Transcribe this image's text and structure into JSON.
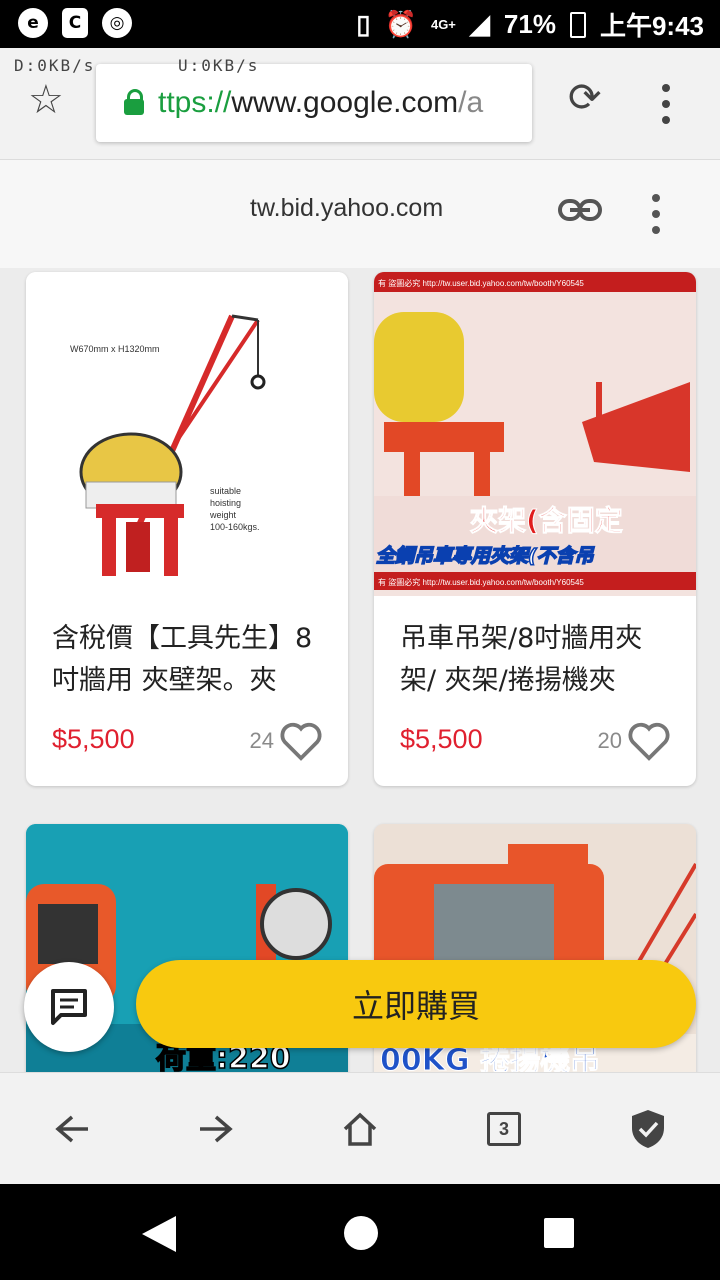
{
  "status_bar": {
    "battery": "71%",
    "time": "上午9:43",
    "network_type": "4G+",
    "net_down": "D:0KB/s",
    "net_up": "U:0KB/s"
  },
  "browser": {
    "url_scheme": "ttps://",
    "url_host": "www.google.com",
    "url_path": "/a",
    "domain": "tw.bid.yahoo.com",
    "tab_count": "3"
  },
  "products": [
    {
      "title": "含稅價【工具先生】8吋牆用 夾壁架。夾",
      "price": "$5,500",
      "likes": "24",
      "image_text": [
        "W670mm x H1320mm",
        "suitable",
        "hoisting",
        "weight",
        "100-160kgs."
      ]
    },
    {
      "title": "吊車吊架/8吋牆用夾架/ 夾架/捲揚機夾",
      "price": "$5,500",
      "likes": "20",
      "image_text": [
        "有 盜圖必究 http://tw.user.bid.yahoo.com/tw/booth/Y60545",
        "夾架(含固定",
        "全鋼吊車專用夾架(不含吊",
        "有 盜圖必究 http://tw.user.bid.yahoo.com/tw/booth/Y60545"
      ]
    },
    {
      "title": "",
      "image_text": [
        "荷重:220"
      ]
    },
    {
      "title": "",
      "image_text": [
        "00KG 捲揚機吊"
      ]
    }
  ],
  "actions": {
    "buy_now": "立即購買"
  },
  "colors": {
    "price": "#e0202f",
    "buy_button": "#f8c90f",
    "lock": "#1a9e3f"
  },
  "icons": [
    "star-icon",
    "lock-icon",
    "reload-icon",
    "more-icon",
    "link-icon",
    "heart-icon",
    "chat-icon",
    "back-icon",
    "forward-icon",
    "home-icon",
    "shield-icon"
  ]
}
